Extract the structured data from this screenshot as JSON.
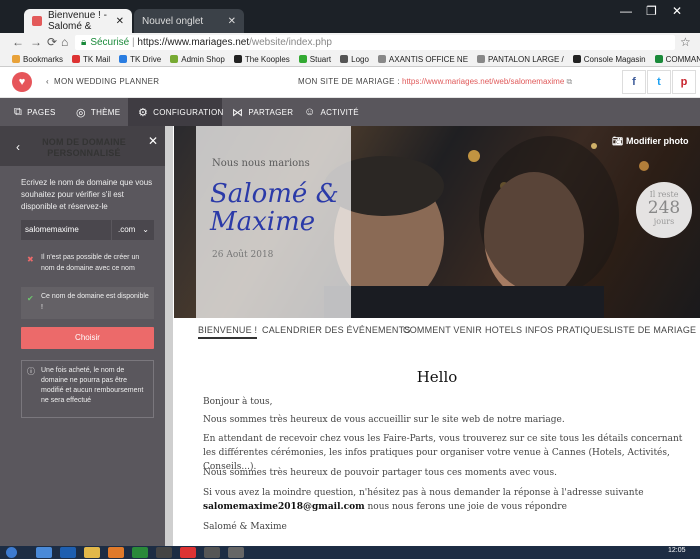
{
  "browser": {
    "tabs": [
      {
        "title": "Bienvenue ! - Salomé &",
        "active": true
      },
      {
        "title": "Nouvel onglet",
        "active": false
      }
    ],
    "security_label": "Sécurisé",
    "url_host": "https://www.mariages.net",
    "url_path": "/website/index.php",
    "bookmarks": [
      {
        "label": "Bookmarks",
        "color": "#e8a23a"
      },
      {
        "label": "TK Mail",
        "color": "#d33"
      },
      {
        "label": "TK Drive",
        "color": "#2a7de1"
      },
      {
        "label": "Admin Shop",
        "color": "#7a3"
      },
      {
        "label": "The Kooples",
        "color": "#222"
      },
      {
        "label": "Stuart",
        "color": "#3a3"
      },
      {
        "label": "Logo",
        "color": "#555"
      },
      {
        "label": "AXANTIS OFFICE NE",
        "color": "#888"
      },
      {
        "label": "PANTALON LARGE /",
        "color": "#888"
      },
      {
        "label": "Console Magasin",
        "color": "#222"
      },
      {
        "label": "COMMANDES EXCE",
        "color": "#1a8a3a"
      }
    ]
  },
  "app": {
    "back_label": "MON WEDDING PLANNER",
    "site_label": "MON SITE DE MARIAGE :",
    "site_url": "https://www.mariages.net/web/salomemaxime",
    "toolbar": [
      {
        "label": "PAGES",
        "icon": "layers-icon"
      },
      {
        "label": "THÈME",
        "icon": "palette-icon"
      },
      {
        "label": "CONFIGURATION",
        "icon": "gear-icon"
      },
      {
        "label": "PARTAGER",
        "icon": "share-icon"
      },
      {
        "label": "ACTIVITÉ",
        "icon": "user-icon"
      }
    ],
    "active_tool": "CONFIGURATION"
  },
  "sidebar": {
    "title": "NOM DE DOMAINE PERSONNALISÉ",
    "intro": "Ecrivez le nom de domaine que vous souhaitez pour vérifier s'il est disponible et réservez-le",
    "domain_value": "salomemaxime",
    "tld_value": ".com",
    "error_msg": "Il n'est pas possible de créer un nom de domaine avec ce nom",
    "ok_msg": "Ce nom de domaine est disponible !",
    "choose_label": "Choisir",
    "info": "Une fois acheté, le nom de domaine ne pourra pas être modifié et aucun remboursement ne sera effectué"
  },
  "hero": {
    "subtitle": "Nous nous marions",
    "names": "Salomé & Maxime",
    "date": "26 Août 2018",
    "modify_photo": "Modifier photo",
    "countdown_top": "Il reste",
    "countdown_value": "248",
    "countdown_unit": "jours"
  },
  "site_nav": [
    "BIENVENUE !",
    "CALENDRIER DES ÉVÉNEMENTS",
    "COMMENT VENIR",
    "HOTELS",
    "INFOS PRATIQUES",
    "LISTE DE MARIAGE"
  ],
  "content": {
    "heading": "Hello",
    "p1": "Bonjour à tous,",
    "p2": "Nous sommes très heureux de vous accueillir sur le site web de notre mariage.",
    "p3": "En attendant de recevoir chez vous les Faire-Parts, vous trouverez sur ce site tous les détails concernant les différentes cérémonies, les infos pratiques pour organiser votre venue à Cannes (Hotels, Activités, Conseils...).",
    "p4": "Nous sommes très heureux de pouvoir partager tous ces moments avec vous.",
    "p5a": "Si vous avez la moindre question, n'hésitez pas à nous demander la réponse à l'adresse suivante",
    "email": "salomemaxime2018@gmail.com",
    "p5b": " nous nous ferons une joie de vous répondre",
    "signature": "Salomé & Maxime"
  },
  "taskbar": {
    "clock": "12:05"
  },
  "colors": {
    "accent": "#ec6a6a",
    "sidebar": "#5a575d",
    "toolbar": "#59565c",
    "names": "#2b3aa8"
  }
}
